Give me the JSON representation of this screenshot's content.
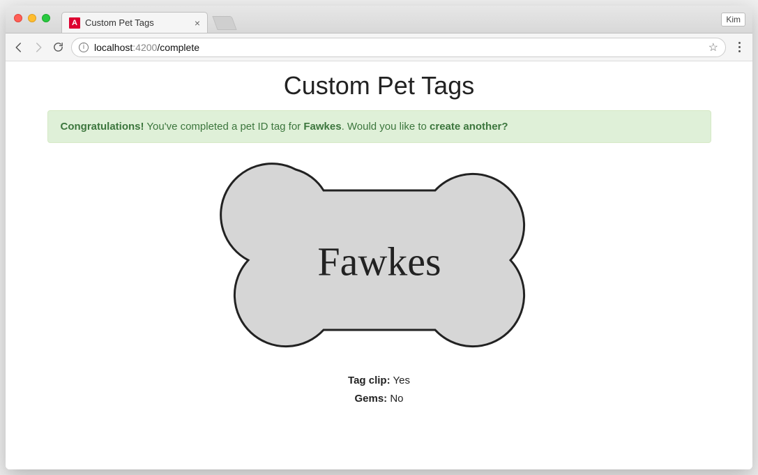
{
  "browser": {
    "tab_title": "Custom Pet Tags",
    "profile_name": "Kim",
    "url_host": "localhost",
    "url_port": ":4200",
    "url_path": "/complete"
  },
  "page": {
    "title": "Custom Pet Tags"
  },
  "alert": {
    "strong": "Congratulations!",
    "text1": " You've completed a pet ID tag for ",
    "pet_name_strong": "Fawkes",
    "text2": ". Would you like to ",
    "link_text": "create another?"
  },
  "tag": {
    "pet_name": "Fawkes"
  },
  "details": {
    "clip_label": "Tag clip:",
    "clip_value": " Yes",
    "gems_label": "Gems:",
    "gems_value": " No"
  }
}
